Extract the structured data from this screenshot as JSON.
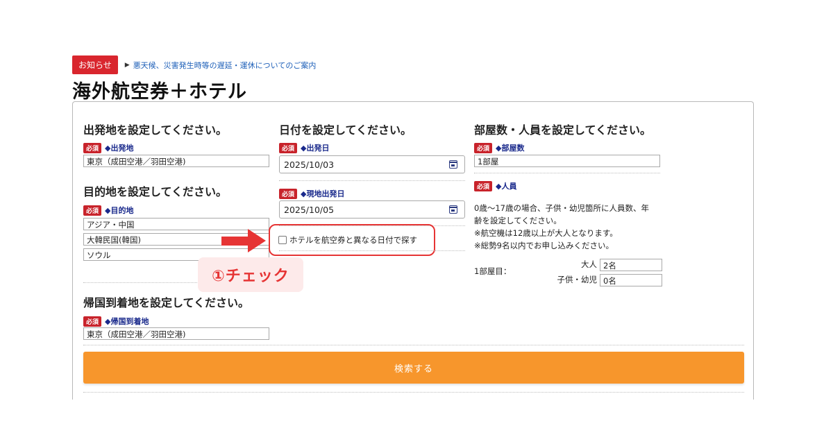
{
  "notice": {
    "badge": "お知らせ",
    "link": "悪天候、災害発生時等の遅延・運休についてのご案内"
  },
  "page_title": "海外航空券＋ホテル",
  "required_label": "必須",
  "departure": {
    "heading": "出発地を設定してください。",
    "label": "◆出発地",
    "value": "東京（成田空港／羽田空港)"
  },
  "destination": {
    "heading": "目的地を設定してください。",
    "label": "◆目的地",
    "region": "アジア・中国",
    "country": "大韓民国(韓国)",
    "city": "ソウル"
  },
  "return_arrival": {
    "heading": "帰国到着地を設定してください。",
    "label": "◆帰国到着地",
    "value": "東京（成田空港／羽田空港)"
  },
  "dates": {
    "heading": "日付を設定してください。",
    "departure_label": "◆出発日",
    "departure_value": "2025/10/03",
    "local_departure_label": "◆現地出発日",
    "local_departure_value": "2025/10/05",
    "hotel_checkbox_label": "ホテルを航空券と異なる日付で探す",
    "hotel_checkbox_checked": false
  },
  "annotation": {
    "check_note": "①チェック",
    "accent": "#e63434"
  },
  "rooms": {
    "heading": "部屋数・人員を設定してください。",
    "rooms_label": "◆部屋数",
    "rooms_value": "1部屋",
    "people_label": "◆人員",
    "info_line1": "0歳〜17歳の場合、子供・幼児箇所に人員数、年",
    "info_line2": "齢を設定してください。",
    "info_line3": "※航空機は12歳以上が大人となります。",
    "info_line4": "※総勢9名以内でお申し込みください。",
    "room1_label": "1部屋目：",
    "adult_label": "大人",
    "adult_value": "2名",
    "child_label": "子供・幼児",
    "child_value": "0名"
  },
  "search_button": "検索する",
  "colors": {
    "search_button": "#f7962c",
    "required_badge": "#c8232b",
    "field_label": "#1a2a8c",
    "notice_badge": "#d9262e"
  }
}
